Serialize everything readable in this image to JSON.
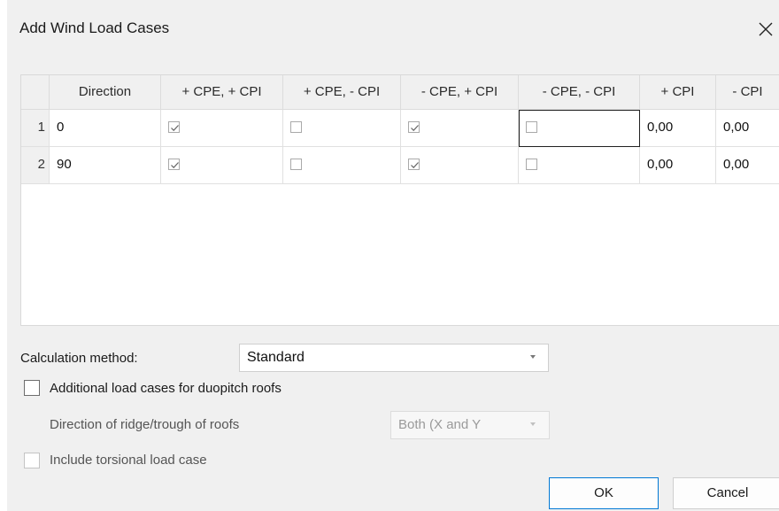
{
  "dialog": {
    "title": "Add Wind Load Cases"
  },
  "grid": {
    "columns": [
      "Direction",
      "+ CPE, + CPI",
      "+ CPE, - CPI",
      "- CPE, + CPI",
      "- CPE, - CPI",
      "+ CPI",
      "- CPI"
    ],
    "rows": [
      {
        "num": "1",
        "direction": "0",
        "checks": [
          true,
          false,
          true,
          false
        ],
        "cpi_plus": "0,00",
        "cpi_minus": "0,00"
      },
      {
        "num": "2",
        "direction": "90",
        "checks": [
          true,
          false,
          true,
          false
        ],
        "cpi_plus": "0,00",
        "cpi_minus": "0,00"
      }
    ]
  },
  "calc_method": {
    "label": "Calculation method:",
    "value": "Standard"
  },
  "duopitch": {
    "label": "Additional load cases for duopitch roofs",
    "checked": false
  },
  "ridge": {
    "label": "Direction of ridge/trough of roofs",
    "value": "Both (X and Y"
  },
  "torsional": {
    "label": "Include torsional load case",
    "checked": false
  },
  "buttons": {
    "ok": "OK",
    "cancel": "Cancel"
  }
}
